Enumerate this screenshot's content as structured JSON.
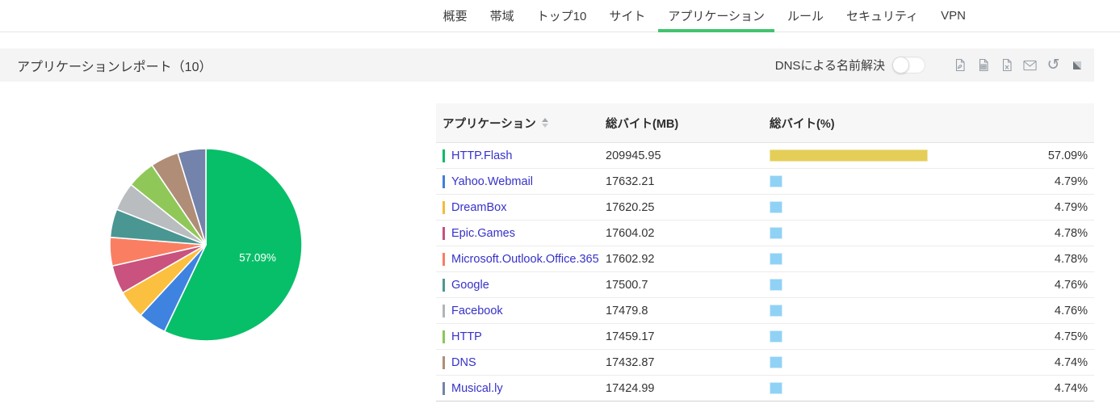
{
  "accent_color": "#41c46e",
  "nav": {
    "tabs": [
      {
        "label": "概要",
        "active": false
      },
      {
        "label": "帯域",
        "active": false
      },
      {
        "label": "トップ10",
        "active": false
      },
      {
        "label": "サイト",
        "active": false
      },
      {
        "label": "アプリケーション",
        "active": true
      },
      {
        "label": "ルール",
        "active": false
      },
      {
        "label": "セキュリティ",
        "active": false
      },
      {
        "label": "VPN",
        "active": false
      }
    ]
  },
  "header": {
    "title": "アプリケーションレポート（10）",
    "dns_toggle_label": "DNSによる名前解決",
    "dns_toggle_state": "off",
    "icons": [
      "pdf-export-icon",
      "csv-export-icon",
      "excel-export-icon",
      "email-icon",
      "refresh-icon",
      "expand-icon"
    ],
    "refresh_glyph": "↺"
  },
  "table": {
    "columns": {
      "application": "アプリケーション",
      "total_mb": "総バイト(MB)",
      "total_pct": "総バイト(%)"
    },
    "rows": [
      {
        "name": "HTTP.Flash",
        "mb": "209945.95",
        "pct": 57.09,
        "pct_label": "57.09%",
        "tick_color": "#0cb968",
        "bar_color": "#e4ce57",
        "bar_border": "#efe4a8"
      },
      {
        "name": "Yahoo.Webmail",
        "mb": "17632.21",
        "pct": 4.79,
        "pct_label": "4.79%",
        "tick_color": "#3f7fdb",
        "bar_color": "#90d2f5",
        "bar_border": "#d3ecfb"
      },
      {
        "name": "DreamBox",
        "mb": "17620.25",
        "pct": 4.79,
        "pct_label": "4.79%",
        "tick_color": "#f6b93d",
        "bar_color": "#90d2f5",
        "bar_border": "#d3ecfb"
      },
      {
        "name": "Epic.Games",
        "mb": "17604.02",
        "pct": 4.78,
        "pct_label": "4.78%",
        "tick_color": "#c4527e",
        "bar_color": "#90d2f5",
        "bar_border": "#d3ecfb"
      },
      {
        "name": "Microsoft.Outlook.Office.365",
        "mb": "17602.92",
        "pct": 4.78,
        "pct_label": "4.78%",
        "tick_color": "#f57f62",
        "bar_color": "#90d2f5",
        "bar_border": "#d3ecfb"
      },
      {
        "name": "Google",
        "mb": "17500.7",
        "pct": 4.76,
        "pct_label": "4.76%",
        "tick_color": "#4d9793",
        "bar_color": "#90d2f5",
        "bar_border": "#d3ecfb"
      },
      {
        "name": "Facebook",
        "mb": "17479.8",
        "pct": 4.76,
        "pct_label": "4.76%",
        "tick_color": "#b1b5b8",
        "bar_color": "#90d2f5",
        "bar_border": "#d3ecfb"
      },
      {
        "name": "HTTP",
        "mb": "17459.17",
        "pct": 4.75,
        "pct_label": "4.75%",
        "tick_color": "#8cc659",
        "bar_color": "#90d2f5",
        "bar_border": "#d3ecfb"
      },
      {
        "name": "DNS",
        "mb": "17432.87",
        "pct": 4.74,
        "pct_label": "4.74%",
        "tick_color": "#b08d75",
        "bar_color": "#90d2f5",
        "bar_border": "#d3ecfb"
      },
      {
        "name": "Musical.ly",
        "mb": "17424.99",
        "pct": 4.74,
        "pct_label": "4.74%",
        "tick_color": "#7384ab",
        "bar_color": "#90d2f5",
        "bar_border": "#d3ecfb"
      }
    ]
  },
  "chart_data": {
    "type": "pie",
    "title": "",
    "labels": [
      "HTTP.Flash",
      "Yahoo.Webmail",
      "DreamBox",
      "Epic.Games",
      "Microsoft.Outlook.Office.365",
      "Google",
      "Facebook",
      "HTTP",
      "DNS",
      "Musical.ly"
    ],
    "values": [
      57.09,
      4.79,
      4.79,
      4.78,
      4.78,
      4.76,
      4.76,
      4.75,
      4.74,
      4.74
    ],
    "colors": [
      "#07bf69",
      "#3f83e0",
      "#fbc040",
      "#c9527f",
      "#fa7f62",
      "#4a9693",
      "#b9bdc0",
      "#8fc858",
      "#b08d76",
      "#7383ab"
    ],
    "start_angle_deg": 0,
    "direction": "clockwise",
    "legend_position": "none",
    "center_label": "57.09%"
  }
}
